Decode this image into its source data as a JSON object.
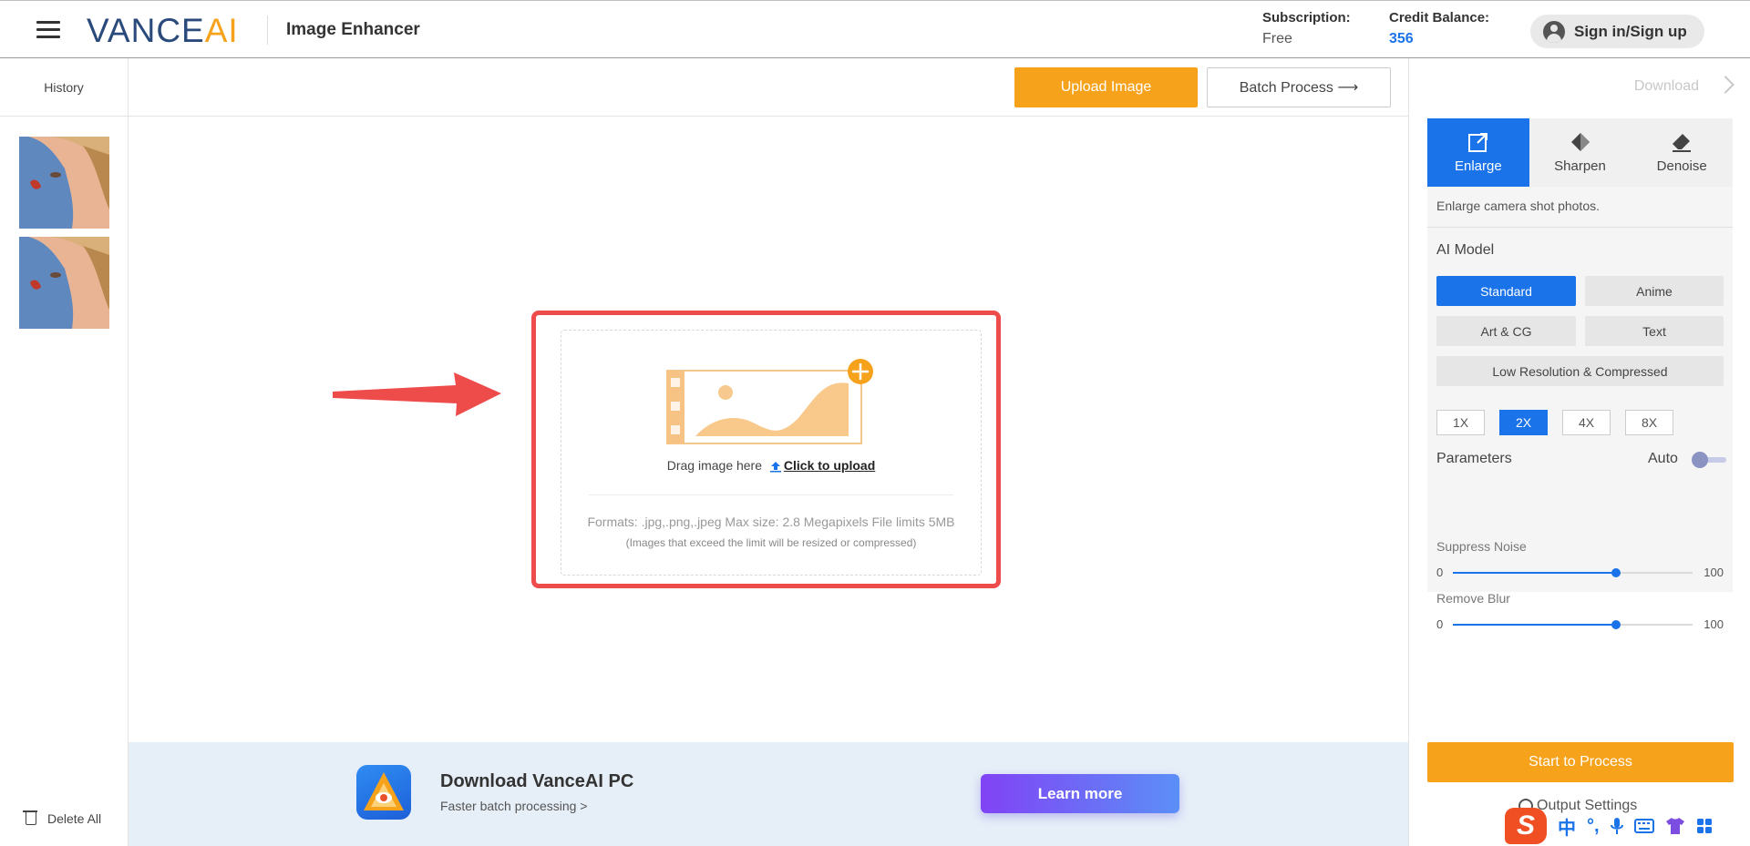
{
  "header": {
    "logo_main": "VANCE",
    "logo_accent": "AI",
    "app_title": "Image Enhancer",
    "subscription_label": "Subscription:",
    "subscription_value": "Free",
    "credit_label": "Credit Balance:",
    "credit_value": "356",
    "signin_label": "Sign in/Sign up"
  },
  "sidebar": {
    "history_label": "History",
    "delete_all_label": "Delete All"
  },
  "toolbar": {
    "upload_label": "Upload Image",
    "batch_label": "Batch Process ⟶"
  },
  "upload": {
    "drag_text": "Drag image here",
    "click_text": "Click to upload",
    "formats": "Formats: .jpg,.png,.jpeg Max size: 2.8 Megapixels File limits 5MB",
    "note": "(Images that exceed the limit will be resized or compressed)"
  },
  "banner": {
    "title": "Download VanceAI PC",
    "subtitle": "Faster batch processing >",
    "cta": "Learn more"
  },
  "panel": {
    "download_label": "Download",
    "tabs": [
      {
        "label": "Enlarge",
        "icon": "enlarge-icon",
        "active": true
      },
      {
        "label": "Sharpen",
        "icon": "sharpen-icon",
        "active": false
      },
      {
        "label": "Denoise",
        "icon": "eraser-icon",
        "active": false
      }
    ],
    "description": "Enlarge camera shot photos.",
    "ai_model_label": "AI Model",
    "models": [
      {
        "label": "Standard",
        "active": true
      },
      {
        "label": "Anime",
        "active": false
      },
      {
        "label": "Art & CG",
        "active": false
      },
      {
        "label": "Text",
        "active": false
      },
      {
        "label": "Low Resolution & Compressed",
        "active": false
      }
    ],
    "scales": [
      {
        "label": "1X",
        "active": false
      },
      {
        "label": "2X",
        "active": true
      },
      {
        "label": "4X",
        "active": false
      },
      {
        "label": "8X",
        "active": false
      }
    ],
    "parameters_label": "Parameters",
    "auto_label": "Auto",
    "auto_on": false,
    "sliders": [
      {
        "label": "Suppress Noise",
        "min": "0",
        "max": "100",
        "value": 68
      },
      {
        "label": "Remove Blur",
        "min": "0",
        "max": "100",
        "value": 68
      }
    ],
    "start_label": "Start to Process",
    "output_settings_label": "Output Settings"
  },
  "ime": {
    "logo": "S",
    "lang": "中",
    "punct": "°,"
  },
  "colors": {
    "accent_orange": "#f7a21b",
    "accent_blue": "#1a73e8",
    "highlight_red": "#ee4b4b",
    "brand_navy": "#2b4a7c"
  }
}
